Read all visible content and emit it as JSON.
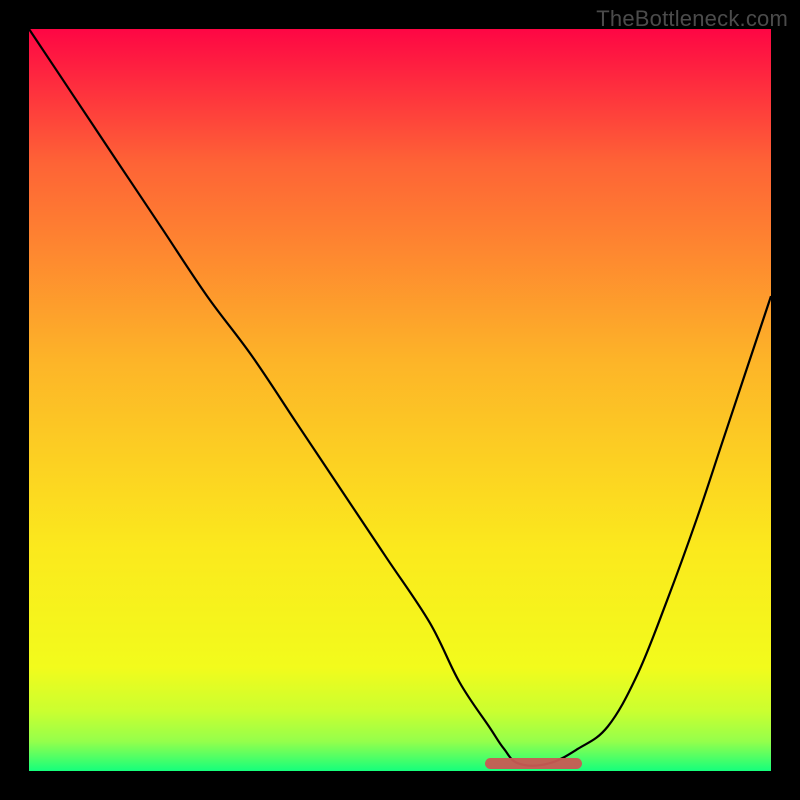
{
  "watermark": "TheBottleneck.com",
  "colors": {
    "gradient_top": "#fe0644",
    "gradient_mid1": "#fe6336",
    "gradient_mid2": "#fdb528",
    "gradient_mid3": "#fbe91d",
    "gradient_mid4": "#f2fb1c",
    "gradient_mid5": "#caff30",
    "gradient_mid6": "#95ff4b",
    "gradient_bottom": "#15ff7c",
    "curve": "#000000",
    "marker": "#c85a54",
    "frame": "#000000"
  },
  "chart_data": {
    "type": "line",
    "title": "",
    "xlabel": "",
    "ylabel": "",
    "xlim": [
      0,
      100
    ],
    "ylim": [
      0,
      100
    ],
    "grid": false,
    "series": [
      {
        "name": "bottleneck-curve",
        "x": [
          0,
          6,
          12,
          18,
          24,
          30,
          36,
          42,
          48,
          54,
          58,
          62,
          64,
          66,
          70,
          74,
          78,
          82,
          86,
          90,
          94,
          100
        ],
        "y": [
          100,
          91,
          82,
          73,
          64,
          56,
          47,
          38,
          29,
          20,
          12,
          6,
          3,
          1,
          1,
          3,
          6,
          13,
          23,
          34,
          46,
          64
        ]
      }
    ],
    "flat_region": {
      "start_x": 62,
      "end_x": 74,
      "y": 1
    },
    "annotations": []
  }
}
